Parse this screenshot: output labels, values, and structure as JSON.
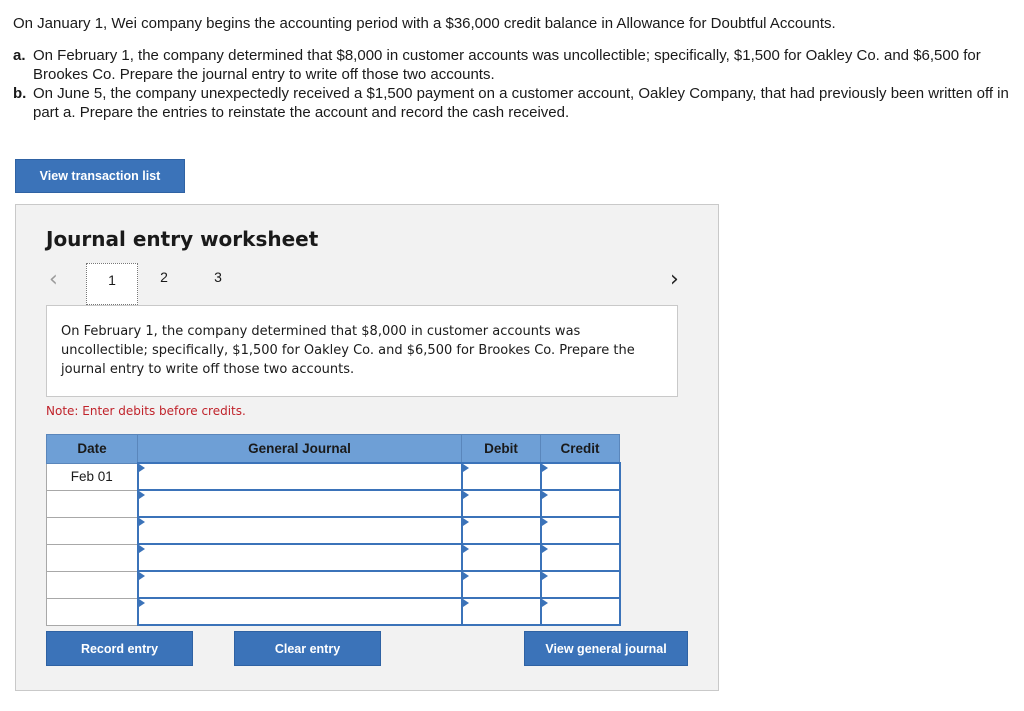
{
  "intro": {
    "line1": "On January 1, Wei company begins the accounting period with a $36,000 credit balance in Allowance for Doubtful Accounts.",
    "parts": [
      {
        "label": "a.",
        "text": "On February 1, the company determined that $8,000 in customer accounts was uncollectible; specifically, $1,500 for Oakley Co. and $6,500 for Brookes Co. Prepare the journal entry to write off those two accounts."
      },
      {
        "label": "b.",
        "text": "On June 5, the company unexpectedly received a $1,500 payment on a customer account, Oakley Company, that had previously been written off in part a. Prepare the entries to reinstate the account and record the cash received."
      }
    ]
  },
  "view_transaction_list_label": "View transaction list",
  "worksheet": {
    "title": "Journal entry worksheet",
    "prev_icon": "chevron-left-icon",
    "next_icon": "chevron-right-icon",
    "pages": [
      "1",
      "2",
      "3"
    ],
    "active_page": "1",
    "description": "On February 1, the company determined that $8,000 in customer accounts was uncollectible; specifically, $1,500 for Oakley Co. and $6,500 for Brookes Co. Prepare the journal entry to write off those two accounts.",
    "note": "Note: Enter debits before credits.",
    "table": {
      "headers": [
        "Date",
        "General Journal",
        "Debit",
        "Credit"
      ],
      "rows": [
        {
          "date": "Feb 01",
          "account": "",
          "debit": "",
          "credit": ""
        },
        {
          "date": "",
          "account": "",
          "debit": "",
          "credit": ""
        },
        {
          "date": "",
          "account": "",
          "debit": "",
          "credit": ""
        },
        {
          "date": "",
          "account": "",
          "debit": "",
          "credit": ""
        },
        {
          "date": "",
          "account": "",
          "debit": "",
          "credit": ""
        },
        {
          "date": "",
          "account": "",
          "debit": "",
          "credit": ""
        }
      ]
    },
    "buttons": {
      "record": "Record entry",
      "clear": "Clear entry",
      "view_journal": "View general journal"
    }
  },
  "colors": {
    "accent": "#3b73b9",
    "header": "#6e9fd6",
    "note": "#c0232b"
  }
}
